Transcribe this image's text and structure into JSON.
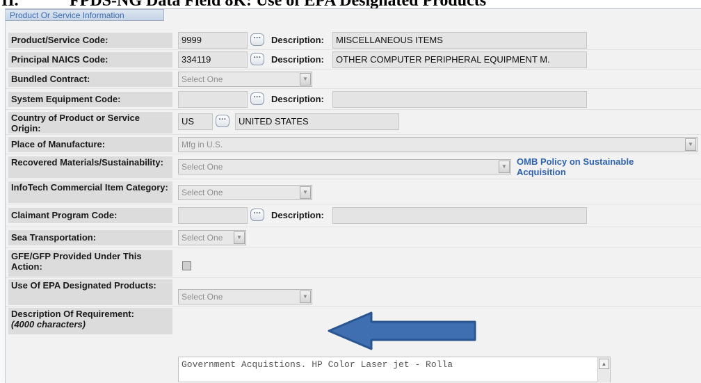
{
  "document": {
    "heading_num": "II.",
    "heading_text": "FPDS-NG Data Field 8K: Use of EPA Designated Products"
  },
  "panel": {
    "title": "Product Or Service Information"
  },
  "fields": {
    "psc": {
      "label": "Product/Service Code:",
      "value": "9999",
      "desc_label": "Description:",
      "desc_value": "MISCELLANEOUS ITEMS"
    },
    "naics": {
      "label": "Principal NAICS Code:",
      "value": "334119",
      "desc_label": "Description:",
      "desc_value": "OTHER COMPUTER PERIPHERAL EQUIPMENT M."
    },
    "bundled": {
      "label": "Bundled Contract:",
      "selected": "Select One"
    },
    "system_equipment": {
      "label": "System Equipment Code:",
      "value": "",
      "desc_label": "Description:",
      "desc_value": ""
    },
    "country": {
      "label": "Country of Product or Service Origin:",
      "code": "US",
      "name": "UNITED STATES"
    },
    "place_of_manufacture": {
      "label": "Place of Manufacture:",
      "selected": "Mfg in U.S."
    },
    "recovered_materials": {
      "label": "Recovered Materials/Sustainability:",
      "selected": "Select One",
      "link": "OMB Policy on Sustainable Acquisition"
    },
    "infotech": {
      "label": "InfoTech Commercial Item Category:",
      "selected": "Select One"
    },
    "claimant": {
      "label": "Claimant Program Code:",
      "value": "",
      "desc_label": "Description:",
      "desc_value": ""
    },
    "sea_transport": {
      "label": "Sea Transportation:",
      "selected": "Select One"
    },
    "gfe_gfp": {
      "label": "GFE/GFP Provided Under This Action:",
      "checked": false
    },
    "epa_products": {
      "label": "Use Of EPA Designated Products:",
      "selected": "Select One"
    },
    "description": {
      "label": "Description Of Requirement:",
      "sublabel": "(4000 characters)",
      "value": "Government Acquistions.  HP Color Laser jet - Rolla"
    }
  },
  "icons": {
    "lookup": "ellipsis-icon",
    "dropdown": "chevron-down-icon",
    "arrow": "left-arrow-icon"
  },
  "colors": {
    "panel_title": "#3b6cb3",
    "link": "#2f62ae",
    "arrow_fill": "#3f6fb0",
    "arrow_stroke": "#2a5590"
  }
}
